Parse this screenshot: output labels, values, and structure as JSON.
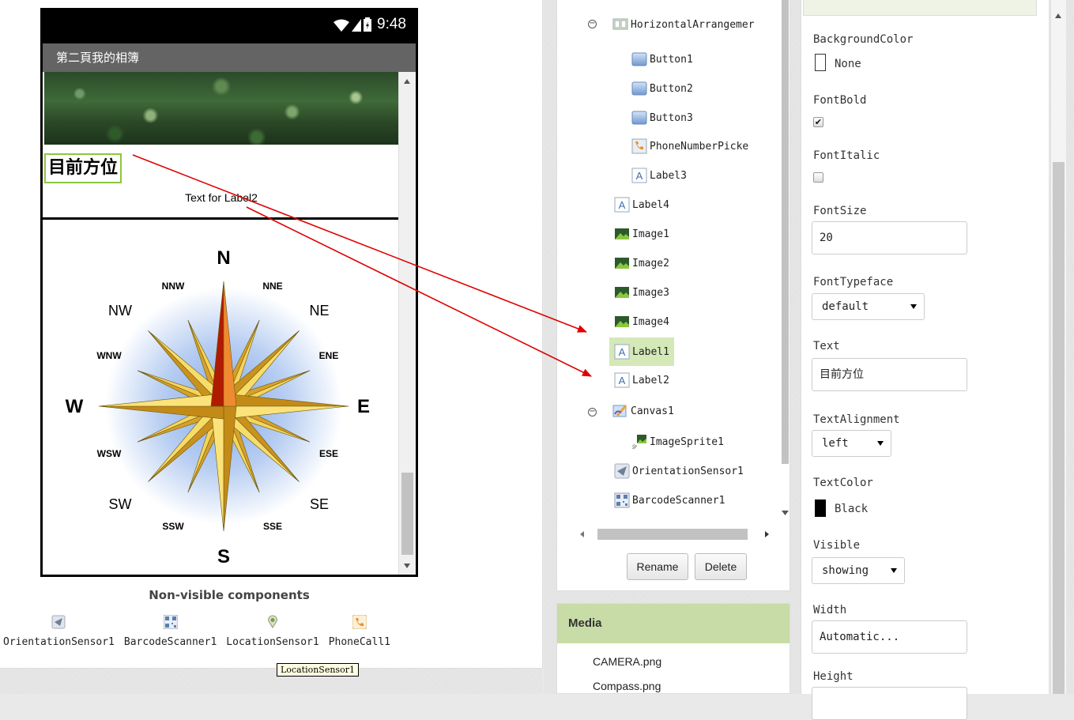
{
  "viewer": {
    "status_time": "9:48",
    "screen_title": "第二頁我的相簿",
    "label1_text": "目前方位",
    "label2_text": "Text for Label2",
    "nonvisible_title": "Non-visible components",
    "nonvisible": [
      {
        "name": "OrientationSensor1",
        "icon": "orientation-sensor-icon"
      },
      {
        "name": "BarcodeScanner1",
        "icon": "barcode-scanner-icon"
      },
      {
        "name": "LocationSensor1",
        "icon": "location-sensor-icon"
      },
      {
        "name": "PhoneCall1",
        "icon": "phone-call-icon"
      }
    ],
    "tooltip": "LocationSensor1",
    "compass": {
      "N": "N",
      "S": "S",
      "E": "E",
      "W": "W",
      "NE": "NE",
      "NW": "NW",
      "SE": "SE",
      "SW": "SW",
      "NNE": "NNE",
      "NNW": "NNW",
      "ENE": "ENE",
      "ESE": "ESE",
      "SSE": "SSE",
      "SSW": "SSW",
      "WSW": "WSW",
      "WNW": "WNW"
    }
  },
  "components": {
    "tree": [
      {
        "label": "HorizontalArrangemer",
        "icon": "horizontal-arrangement-icon",
        "expanded": true
      },
      {
        "label": "Button1",
        "icon": "button-icon"
      },
      {
        "label": "Button2",
        "icon": "button-icon"
      },
      {
        "label": "Button3",
        "icon": "button-icon"
      },
      {
        "label": "PhoneNumberPicke",
        "icon": "phone-number-picker-icon"
      },
      {
        "label": "Label3",
        "icon": "label-icon"
      },
      {
        "label": "Label4",
        "icon": "label-icon"
      },
      {
        "label": "Image1",
        "icon": "image-icon"
      },
      {
        "label": "Image2",
        "icon": "image-icon"
      },
      {
        "label": "Image3",
        "icon": "image-icon"
      },
      {
        "label": "Image4",
        "icon": "image-icon"
      },
      {
        "label": "Label1",
        "icon": "label-icon",
        "selected": true
      },
      {
        "label": "Label2",
        "icon": "label-icon"
      },
      {
        "label": "Canvas1",
        "icon": "canvas-icon",
        "expanded": true
      },
      {
        "label": "ImageSprite1",
        "icon": "image-sprite-icon"
      },
      {
        "label": "OrientationSensor1",
        "icon": "orientation-sensor-icon"
      },
      {
        "label": "BarcodeScanner1",
        "icon": "barcode-scanner-icon"
      }
    ],
    "rename_label": "Rename",
    "delete_label": "Delete",
    "media_title": "Media",
    "media_files": [
      "CAMERA.png",
      "Compass.png"
    ]
  },
  "properties": {
    "background_color_label": "BackgroundColor",
    "background_color_value": "None",
    "font_bold_label": "FontBold",
    "font_bold_checked": true,
    "font_italic_label": "FontItalic",
    "font_italic_checked": false,
    "font_size_label": "FontSize",
    "font_size_value": "20",
    "font_typeface_label": "FontTypeface",
    "font_typeface_value": "default",
    "text_label": "Text",
    "text_value": "目前方位",
    "text_alignment_label": "TextAlignment",
    "text_alignment_value": "left",
    "text_color_label": "TextColor",
    "text_color_value": "Black",
    "visible_label": "Visible",
    "visible_value": "showing",
    "width_label": "Width",
    "width_value": "Automatic...",
    "height_label": "Height"
  },
  "colors": {
    "selected_row": "#d5e8b8",
    "label_border": "#8cc63f",
    "annotation_arrow": "#e00000",
    "text_color_swatch": "#000000"
  }
}
